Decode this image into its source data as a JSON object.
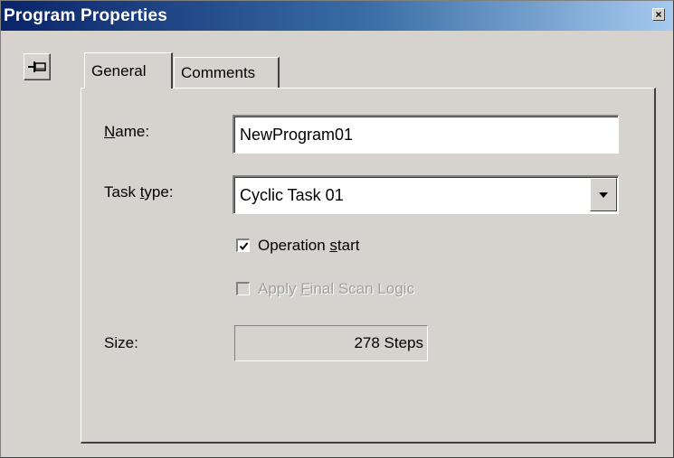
{
  "window": {
    "title": "Program Properties",
    "close_glyph": "×"
  },
  "tabs": [
    {
      "label": "General",
      "active": true
    },
    {
      "label": "Comments",
      "active": false
    }
  ],
  "form": {
    "name_label_mnemonic": "N",
    "name_label_rest": "ame:",
    "name_value": "NewProgram01",
    "task_label_pre": "Task ",
    "task_label_mnemonic": "t",
    "task_label_rest": "ype:",
    "task_value": "Cyclic Task 01",
    "operation_start": {
      "checked": true,
      "label_pre": "Operation ",
      "label_mnemonic": "s",
      "label_rest": "tart"
    },
    "final_scan": {
      "checked": false,
      "disabled": true,
      "label_pre": "Apply ",
      "label_mnemonic": "F",
      "label_rest": "inal Scan Logic"
    },
    "size_label": "Size:",
    "size_value": "278 Steps"
  },
  "icons": {
    "pin": "pin-icon",
    "dropdown": "chevron-down-icon",
    "check": "checkmark-icon"
  },
  "colors": {
    "dialog_bg": "#d6d3ce",
    "titlebar_start": "#0a246a",
    "titlebar_end": "#a6caf0"
  }
}
